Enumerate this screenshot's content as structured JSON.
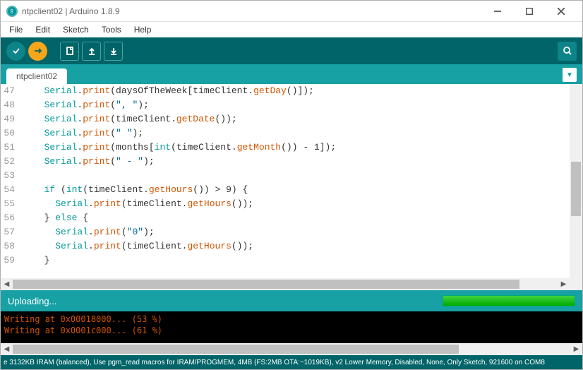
{
  "window": {
    "title": "ntpclient02 | Arduino 1.8.9"
  },
  "menu": {
    "file": "File",
    "edit": "Edit",
    "sketch": "Sketch",
    "tools": "Tools",
    "help": "Help"
  },
  "tabs": {
    "active": "ntpclient02"
  },
  "code_lines": [
    {
      "n": 47,
      "tokens": [
        [
          "pl",
          "  "
        ],
        [
          "kw",
          "Serial"
        ],
        [
          "pl",
          "."
        ],
        [
          "fn",
          "print"
        ],
        [
          "pl",
          "(daysOfTheWeek[timeClient."
        ],
        [
          "fn",
          "getDay"
        ],
        [
          "pl",
          "()]);"
        ]
      ]
    },
    {
      "n": 48,
      "tokens": [
        [
          "pl",
          "  "
        ],
        [
          "kw",
          "Serial"
        ],
        [
          "pl",
          "."
        ],
        [
          "fn",
          "print"
        ],
        [
          "pl",
          "("
        ],
        [
          "str",
          "\", \""
        ],
        [
          "pl",
          ");"
        ]
      ]
    },
    {
      "n": 49,
      "tokens": [
        [
          "pl",
          "  "
        ],
        [
          "kw",
          "Serial"
        ],
        [
          "pl",
          "."
        ],
        [
          "fn",
          "print"
        ],
        [
          "pl",
          "(timeClient."
        ],
        [
          "fn",
          "getDate"
        ],
        [
          "pl",
          "());"
        ]
      ]
    },
    {
      "n": 50,
      "tokens": [
        [
          "pl",
          "  "
        ],
        [
          "kw",
          "Serial"
        ],
        [
          "pl",
          "."
        ],
        [
          "fn",
          "print"
        ],
        [
          "pl",
          "("
        ],
        [
          "str",
          "\" \""
        ],
        [
          "pl",
          ");"
        ]
      ]
    },
    {
      "n": 51,
      "tokens": [
        [
          "pl",
          "  "
        ],
        [
          "kw",
          "Serial"
        ],
        [
          "pl",
          "."
        ],
        [
          "fn",
          "print"
        ],
        [
          "pl",
          "(months["
        ],
        [
          "kw",
          "int"
        ],
        [
          "pl",
          "(timeClient."
        ],
        [
          "fn",
          "getMonth"
        ],
        [
          "pl",
          "()) - 1]);"
        ]
      ]
    },
    {
      "n": 52,
      "tokens": [
        [
          "pl",
          "  "
        ],
        [
          "kw",
          "Serial"
        ],
        [
          "pl",
          "."
        ],
        [
          "fn",
          "print"
        ],
        [
          "pl",
          "("
        ],
        [
          "str",
          "\" - \""
        ],
        [
          "pl",
          ");"
        ]
      ]
    },
    {
      "n": 53,
      "tokens": [
        [
          "pl",
          ""
        ]
      ]
    },
    {
      "n": 54,
      "tokens": [
        [
          "pl",
          "  "
        ],
        [
          "kw",
          "if"
        ],
        [
          "pl",
          " ("
        ],
        [
          "kw",
          "int"
        ],
        [
          "pl",
          "(timeClient."
        ],
        [
          "fn",
          "getHours"
        ],
        [
          "pl",
          "()) > 9) {"
        ]
      ]
    },
    {
      "n": 55,
      "tokens": [
        [
          "pl",
          "    "
        ],
        [
          "kw",
          "Serial"
        ],
        [
          "pl",
          "."
        ],
        [
          "fn",
          "print"
        ],
        [
          "pl",
          "(timeClient."
        ],
        [
          "fn",
          "getHours"
        ],
        [
          "pl",
          "());"
        ]
      ]
    },
    {
      "n": 56,
      "tokens": [
        [
          "pl",
          "  } "
        ],
        [
          "kw",
          "else"
        ],
        [
          "pl",
          " {"
        ]
      ]
    },
    {
      "n": 57,
      "tokens": [
        [
          "pl",
          "    "
        ],
        [
          "kw",
          "Serial"
        ],
        [
          "pl",
          "."
        ],
        [
          "fn",
          "print"
        ],
        [
          "pl",
          "("
        ],
        [
          "str",
          "\"0\""
        ],
        [
          "pl",
          ");"
        ]
      ]
    },
    {
      "n": 58,
      "tokens": [
        [
          "pl",
          "    "
        ],
        [
          "kw",
          "Serial"
        ],
        [
          "pl",
          "."
        ],
        [
          "fn",
          "print"
        ],
        [
          "pl",
          "(timeClient."
        ],
        [
          "fn",
          "getHours"
        ],
        [
          "pl",
          "());"
        ]
      ]
    },
    {
      "n": 59,
      "tokens": [
        [
          "pl",
          "  }"
        ]
      ]
    }
  ],
  "status": {
    "text": "Uploading..."
  },
  "console": {
    "lines": [
      "Writing at 0x00018000... (53 %)",
      "Writing at 0x0001c000... (61 %)"
    ]
  },
  "footer": {
    "left": "e 3132KB IRAM (balanced), Use pgm_read macros for IRAM/PROGMEM, 4MB (FS:2MB OTA:~1019KB), v2 Lower Memory, Disabled, None, Only Sketch, 921600 on COM8"
  }
}
